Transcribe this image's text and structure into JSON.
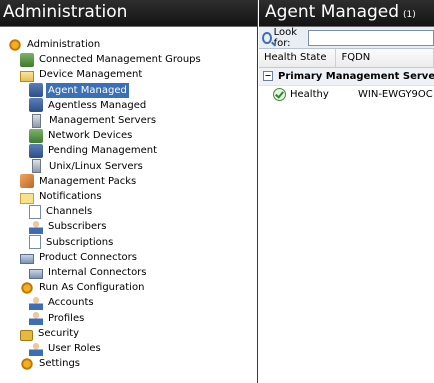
{
  "left_pane": {
    "title": "Administration",
    "tree": [
      {
        "key": "administration",
        "label": "Administration",
        "icon": "administration-gear-icon",
        "depth": 0
      },
      {
        "key": "connected-groups",
        "label": "Connected Management Groups",
        "icon": "network-groups-icon",
        "depth": 1
      },
      {
        "key": "device-management",
        "label": "Device Management",
        "icon": "folder-open-icon",
        "depth": 1
      },
      {
        "key": "agent-managed",
        "label": "Agent Managed",
        "icon": "agent-managed-icon",
        "depth": 2,
        "selected": true
      },
      {
        "key": "agentless-managed",
        "label": "Agentless Managed",
        "icon": "agentless-managed-icon",
        "depth": 2
      },
      {
        "key": "management-servers",
        "label": "Management Servers",
        "icon": "management-server-icon",
        "depth": 2
      },
      {
        "key": "network-devices",
        "label": "Network Devices",
        "icon": "network-device-icon",
        "depth": 2
      },
      {
        "key": "pending-management",
        "label": "Pending Management",
        "icon": "pending-icon",
        "depth": 2
      },
      {
        "key": "unix-linux-servers",
        "label": "Unix/Linux Servers",
        "icon": "server-icon",
        "depth": 2
      },
      {
        "key": "management-packs",
        "label": "Management Packs",
        "icon": "management-pack-icon",
        "depth": 1
      },
      {
        "key": "notifications",
        "label": "Notifications",
        "icon": "mail-icon",
        "depth": 1
      },
      {
        "key": "channels",
        "label": "Channels",
        "icon": "channel-icon",
        "depth": 2
      },
      {
        "key": "subscribers",
        "label": "Subscribers",
        "icon": "user-icon",
        "depth": 2
      },
      {
        "key": "subscriptions",
        "label": "Subscriptions",
        "icon": "document-icon",
        "depth": 2
      },
      {
        "key": "product-connectors",
        "label": "Product Connectors",
        "icon": "connector-icon",
        "depth": 1
      },
      {
        "key": "internal-connectors",
        "label": "Internal Connectors",
        "icon": "connector-icon",
        "depth": 2
      },
      {
        "key": "run-as-configuration",
        "label": "Run As Configuration",
        "icon": "run-as-icon",
        "depth": 1
      },
      {
        "key": "accounts",
        "label": "Accounts",
        "icon": "account-icon",
        "depth": 2
      },
      {
        "key": "profiles",
        "label": "Profiles",
        "icon": "profile-icon",
        "depth": 2
      },
      {
        "key": "security",
        "label": "Security",
        "icon": "lock-icon",
        "depth": 1
      },
      {
        "key": "user-roles",
        "label": "User Roles",
        "icon": "user-icon",
        "depth": 2
      },
      {
        "key": "settings",
        "label": "Settings",
        "icon": "settings-icon",
        "depth": 1
      }
    ]
  },
  "right_pane": {
    "title": "Agent Managed",
    "count": "(1)",
    "look_for_label": "Look for:",
    "search_value": "",
    "columns": [
      "Health State",
      "FQDN"
    ],
    "group_label": "Primary Management Server",
    "rows": [
      {
        "health": "Healthy",
        "fqdn": "WIN-EWGY9OC"
      }
    ]
  },
  "colors": {
    "header_bg": "#1e1e1e",
    "selection": "#3b6fb6",
    "healthy": "#2f8a2f"
  }
}
